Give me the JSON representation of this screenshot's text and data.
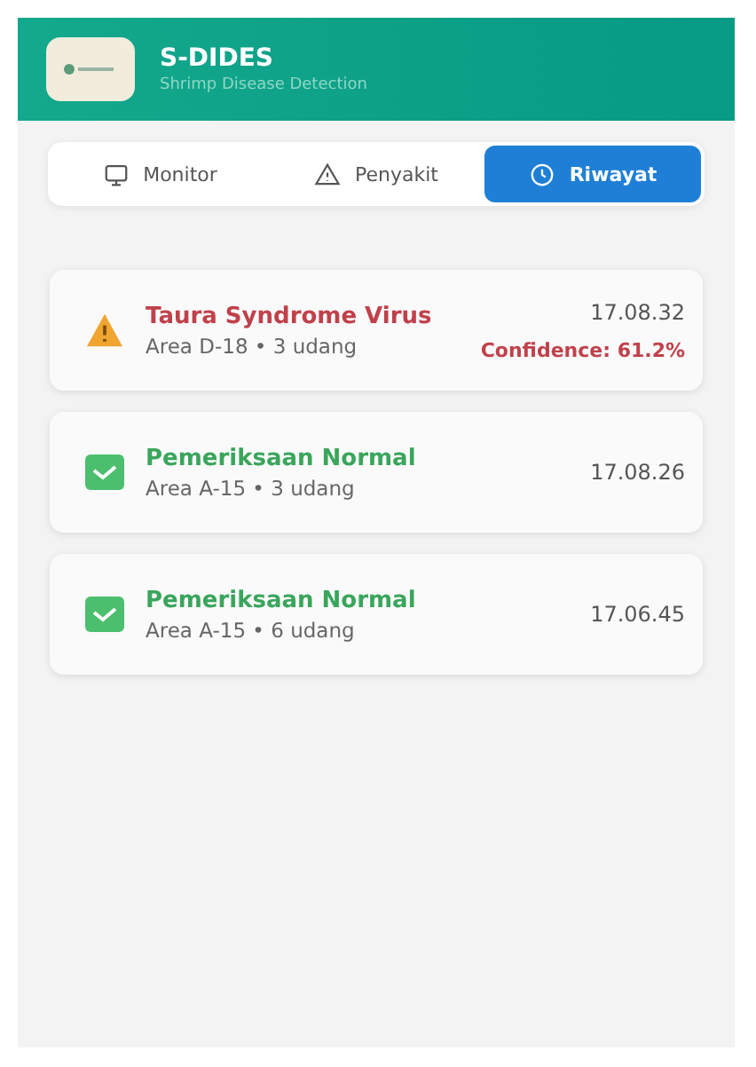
{
  "header": {
    "title": "S-DIDES",
    "subtitle": "Shrimp Disease Detection"
  },
  "tabs": [
    {
      "label": "Monitor",
      "kind": "monitor",
      "selected": false
    },
    {
      "label": "Penyakit",
      "kind": "alert",
      "selected": false
    },
    {
      "label": "Riwayat",
      "kind": "clock",
      "selected": true
    }
  ],
  "history": [
    {
      "kind": "disease",
      "title": "Taura Syndrome Virus",
      "detail": "Area D-18 •  3 udang",
      "time": "17.08.32",
      "confidence": "Confidence: 61.2%"
    },
    {
      "kind": "normal",
      "title": "Pemeriksaan Normal",
      "detail": "Area A-15 • 3 udang",
      "time": "17.08.26"
    },
    {
      "kind": "normal",
      "title": "Pemeriksaan Normal",
      "detail": "Area A-15 • 6 udang",
      "time": "17.06.45"
    }
  ]
}
